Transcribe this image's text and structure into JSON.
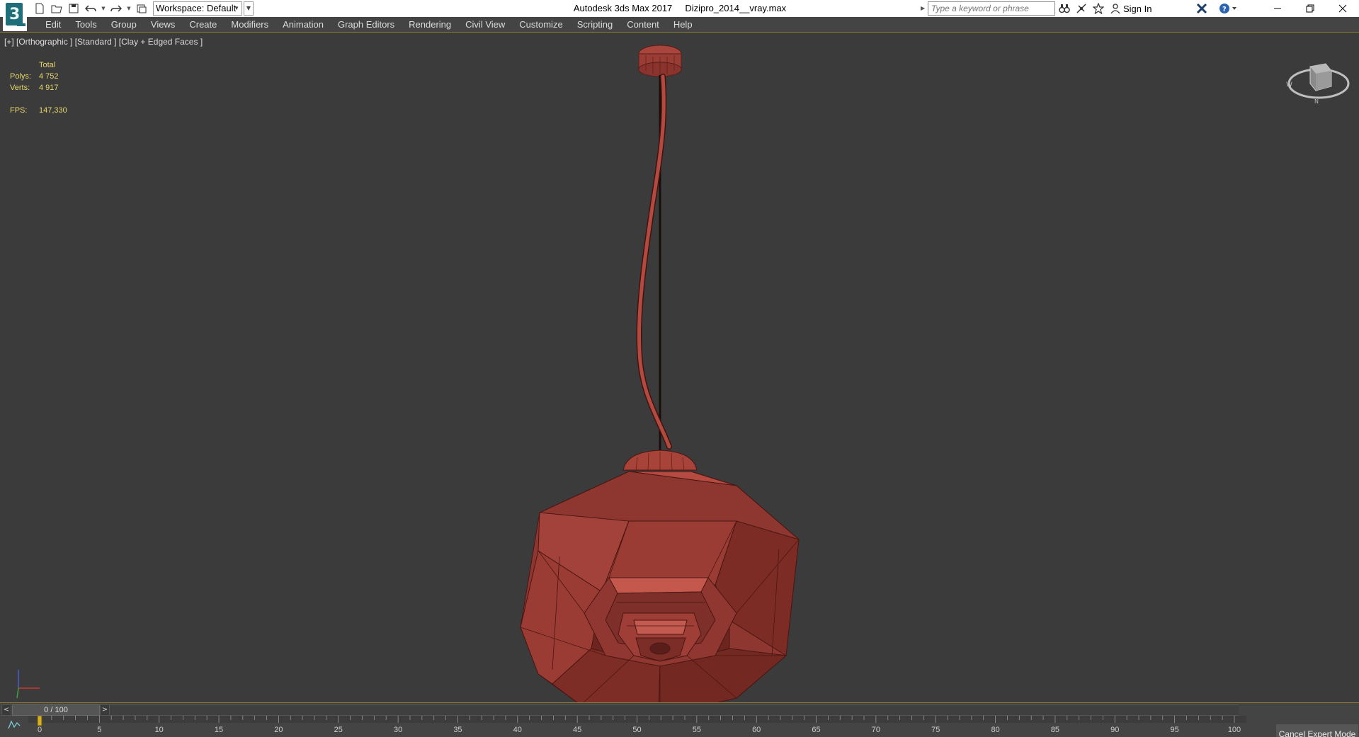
{
  "title_bar": {
    "workspace_label": "Workspace: Default",
    "window_title": "Autodesk 3ds Max 2017     Dizipro_2014__vray.max",
    "search_placeholder": "Type a keyword or phrase",
    "sign_in_label": "Sign In"
  },
  "menu": {
    "items": [
      "Edit",
      "Tools",
      "Group",
      "Views",
      "Create",
      "Modifiers",
      "Animation",
      "Graph Editors",
      "Rendering",
      "Civil View",
      "Customize",
      "Scripting",
      "Content",
      "Help"
    ]
  },
  "viewport": {
    "label": "[+] [Orthographic ] [Standard ] [Clay + Edged Faces ]",
    "stats": {
      "total_label": "Total",
      "polys_label": "Polys:",
      "polys_value": "4 752",
      "verts_label": "Verts:",
      "verts_value": "4 917",
      "fps_label": "FPS:",
      "fps_value": "147,330"
    },
    "model_color": "#b54a40"
  },
  "timeline": {
    "frame_display": "0 / 100",
    "current_frame": 0,
    "ruler_labels": [
      "0",
      "5",
      "10",
      "15",
      "20",
      "25",
      "30",
      "35",
      "40",
      "45",
      "50",
      "55",
      "60",
      "65",
      "70",
      "75",
      "80",
      "85",
      "90",
      "95",
      "100"
    ],
    "cancel_expert_label": "Cancel Expert Mode"
  },
  "colors": {
    "accent_gold": "#8c7a2c",
    "stats_yellow": "#e8d86a",
    "viewport_bg": "#3b3b3b"
  }
}
